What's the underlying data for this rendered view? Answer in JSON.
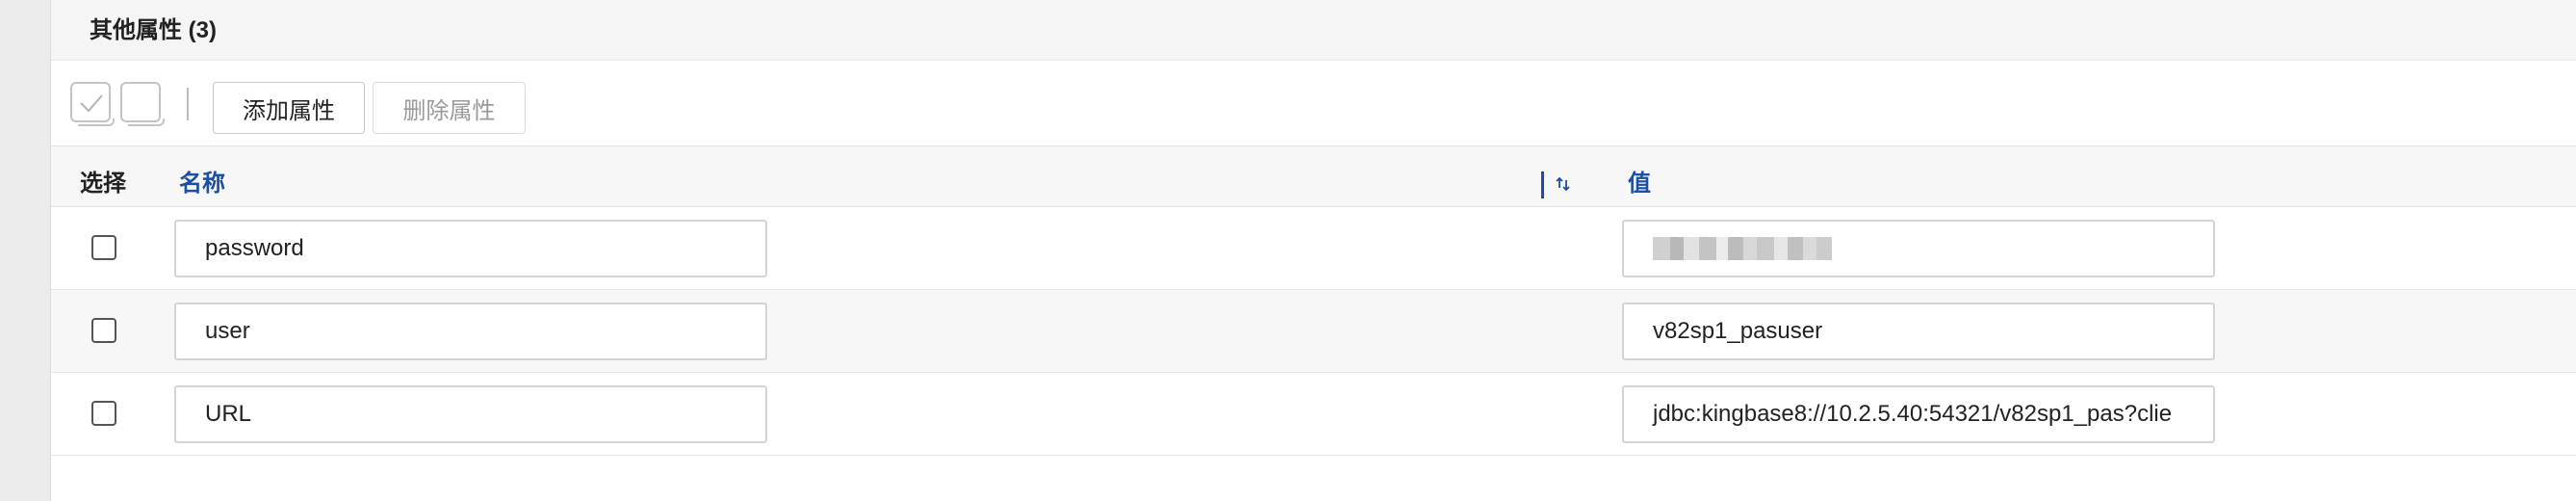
{
  "section": {
    "title": "其他属性 (3)"
  },
  "toolbar": {
    "select_all_icon": "checkbox-checked-icon",
    "deselect_icon": "checkbox-empty-icon",
    "add_label": "添加属性",
    "delete_label": "删除属性"
  },
  "table": {
    "headers": {
      "select": "选择",
      "name": "名称",
      "value": "值"
    },
    "sort_icon": "sort-arrows-icon",
    "rows": [
      {
        "name": "password",
        "value": "",
        "value_masked": true
      },
      {
        "name": "user",
        "value": "v82sp1_pasuser"
      },
      {
        "name": "URL",
        "value": "jdbc:kingbase8://10.2.5.40:54321/v82sp1_pas?clie"
      }
    ]
  },
  "colors": {
    "accent": "#1a4fa3",
    "border": "#d4d4d4",
    "header_bg": "#f5f5f5"
  }
}
